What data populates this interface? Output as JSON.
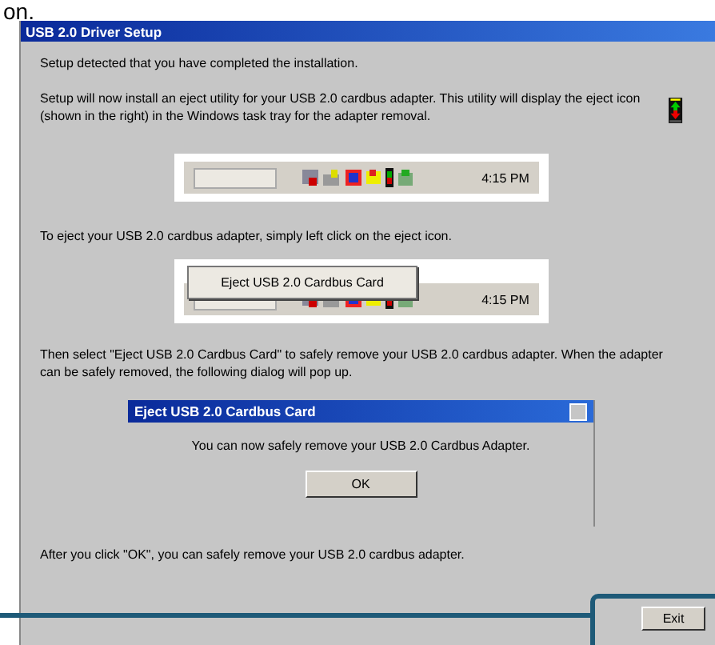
{
  "caption_fragment": "on.",
  "window": {
    "title": "USB 2.0 Driver Setup"
  },
  "intro": "Setup detected that you have completed the installation.",
  "install_note": "Setup will now install an eject utility for your USB 2.0 cardbus adapter. This utility will display the eject icon (shown in the right) in the Windows task tray for the adapter removal.",
  "tray_example": {
    "clock": "4:15 PM"
  },
  "eject_instruction": "To eject your USB 2.0 cardbus adapter, simply left click on the eject icon.",
  "tray_menu_example": {
    "menu_item": "Eject USB 2.0 Cardbus Card",
    "clock": "4:15 PM"
  },
  "select_instruction": "Then select \"Eject USB 2.0 Cardbus Card\" to safely remove your USB 2.0 cardbus adapter. When the adapter can be safely removed, the following dialog will pop up.",
  "dialog": {
    "title": "Eject USB 2.0 Cardbus Card",
    "message": "You can now safely remove your USB 2.0 Cardbus Adapter.",
    "button": "OK"
  },
  "after_note": "After you click \"OK\", you can safely remove your USB 2.0 cardbus adapter.",
  "buttons": [
    {
      "label": "Exit",
      "highlighted": true
    }
  ]
}
